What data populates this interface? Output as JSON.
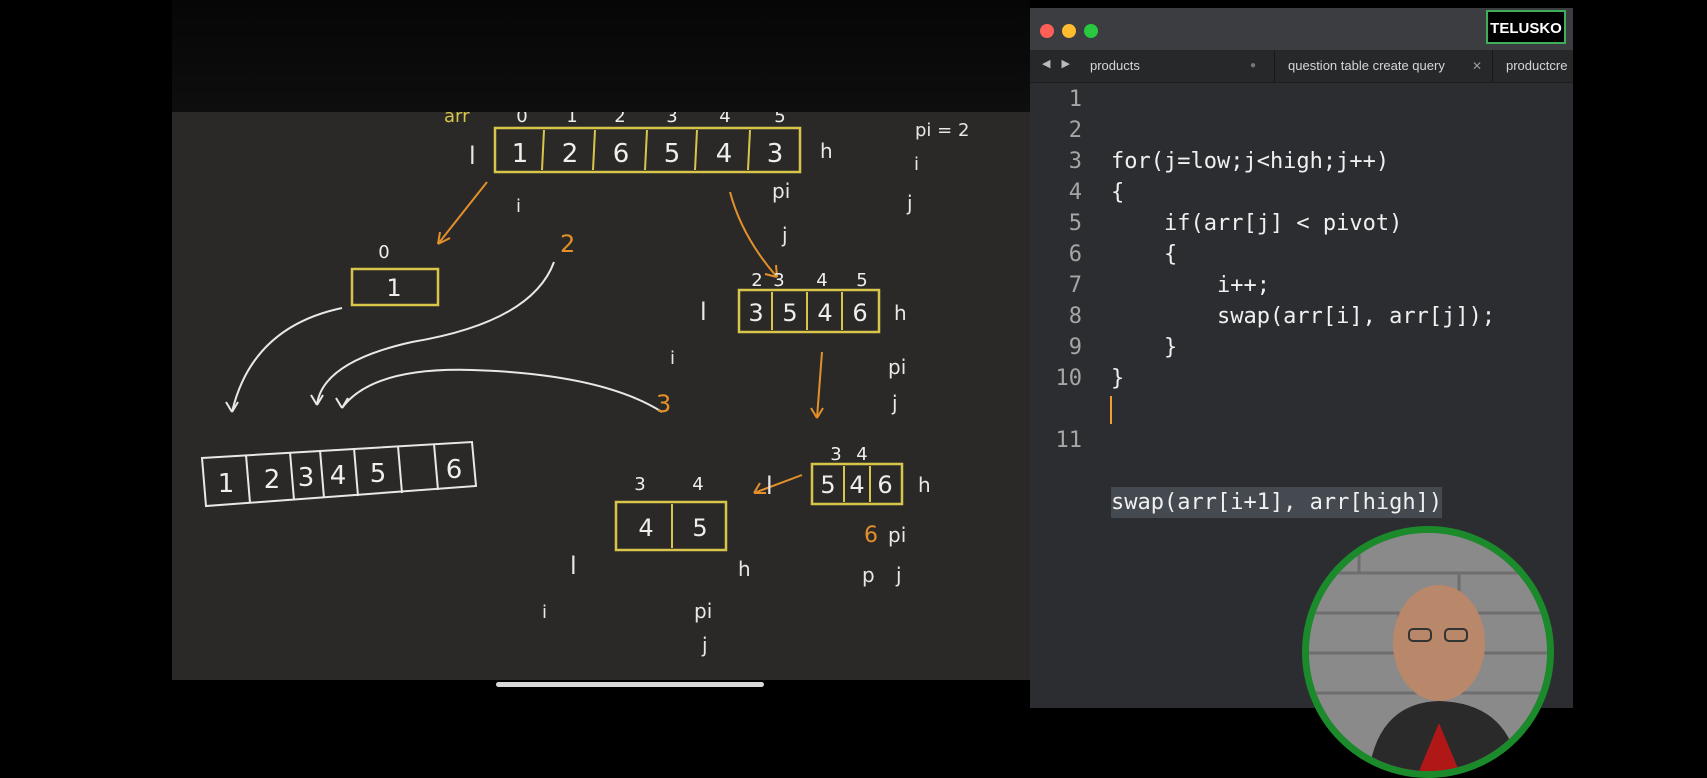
{
  "editor": {
    "brand": "TELUSKO",
    "nav_arrows": "◀ ▶",
    "tabs": [
      {
        "label": "products",
        "marker": "●"
      },
      {
        "label": "question table create query",
        "marker": "✕"
      },
      {
        "label": "productcre"
      }
    ],
    "code_lines": [
      {
        "num": "1",
        "text": ""
      },
      {
        "num": "2",
        "text": ""
      },
      {
        "num": "3",
        "text": "for(j=low;j<high;j++)"
      },
      {
        "num": "4",
        "text": "{"
      },
      {
        "num": "5",
        "text": "    if(arr[j] < pivot)"
      },
      {
        "num": "6",
        "text": "    {"
      },
      {
        "num": "7",
        "text": "        i++;"
      },
      {
        "num": "8",
        "text": "        swap(arr[i], arr[j]);"
      },
      {
        "num": "9",
        "text": "    }"
      },
      {
        "num": "10",
        "text": "}"
      },
      {
        "num": "11",
        "text": "swap(arr[i+1], arr[high])"
      }
    ],
    "highlighted_line": 11,
    "colors": {
      "accent": "#f0a030",
      "brand_border": "#3fae5a"
    }
  },
  "whiteboard": {
    "top_array": {
      "label": "arr",
      "indices": [
        "0",
        "1",
        "2",
        "3",
        "4",
        "5"
      ],
      "values": [
        "1",
        "2",
        "6",
        "5",
        "4",
        "3"
      ],
      "left": "l",
      "right": "h"
    },
    "notes": {
      "pi_eq": "pi = 2",
      "pi": "pi",
      "i": "i",
      "j": "j",
      "p": "p"
    },
    "orange_labels": [
      "2",
      "3",
      "6"
    ],
    "box_one": {
      "index": "0",
      "values": [
        "1"
      ]
    },
    "box_right": {
      "indices": [
        "2",
        "3",
        "4",
        "5"
      ],
      "values": [
        "3",
        "5",
        "4",
        "6"
      ],
      "left": "l",
      "right": "h"
    },
    "box_mid": {
      "indices": [
        "3",
        "4"
      ],
      "values": [
        "5",
        "4",
        "6"
      ],
      "left": "l",
      "right": "h"
    },
    "box_small": {
      "indices": [
        "3",
        "4"
      ],
      "values": [
        "4",
        "5"
      ],
      "left": "l",
      "right": "h"
    },
    "result": {
      "values": [
        "1",
        "2",
        "3",
        "4",
        "5",
        "6"
      ]
    }
  }
}
